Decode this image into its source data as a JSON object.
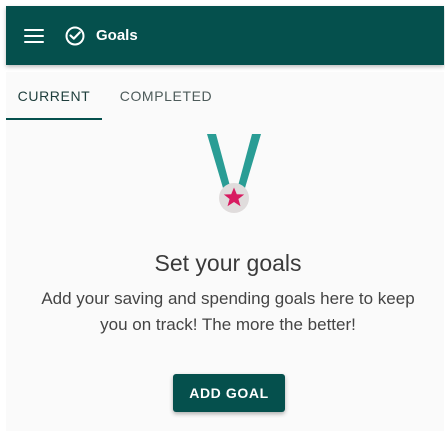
{
  "appbar": {
    "title": "Goals",
    "menu_icon": "menu-icon",
    "app_icon": "goal-check-icon",
    "color": "#05504d"
  },
  "tabs": [
    {
      "label": "CURRENT",
      "selected": true
    },
    {
      "label": "COMPLETED",
      "selected": false
    }
  ],
  "empty_state": {
    "illustration": "medal-star-icon",
    "headline": "Set your goals",
    "description": "Add your saving and spending goals here to keep you on track! The more the better!",
    "button_label": "ADD GOAL",
    "ribbon_color": "#2a9d95",
    "star_color": "#d81b60"
  }
}
